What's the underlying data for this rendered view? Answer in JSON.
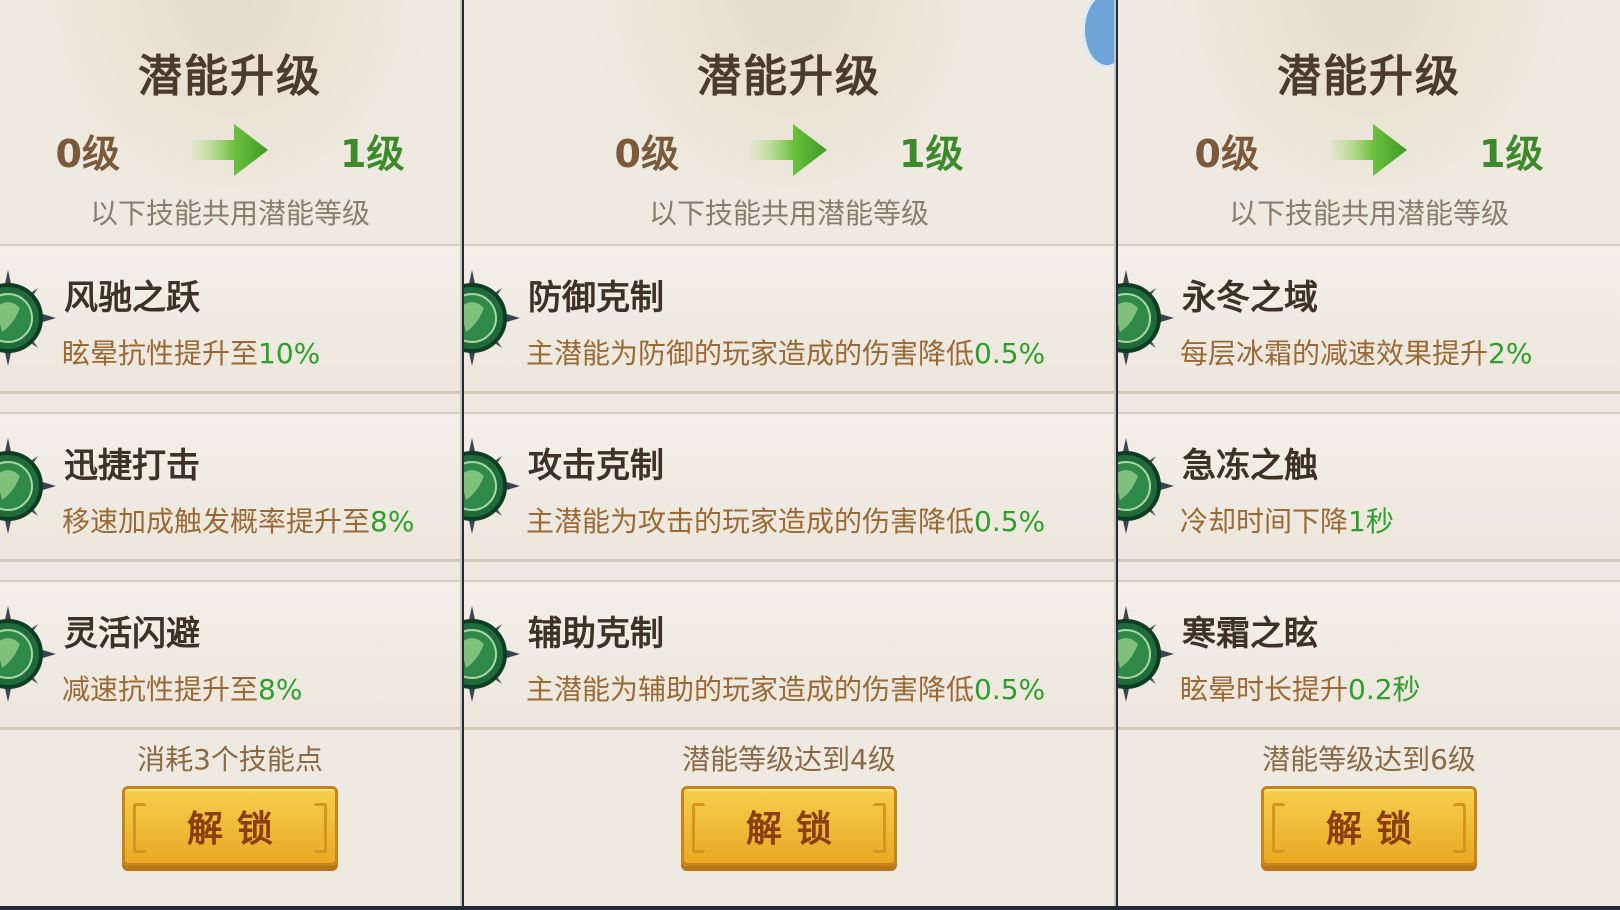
{
  "colors": {
    "panel_bg": "#efeae1",
    "level_from": "#7a5a3a",
    "level_to": "#3d8a2a",
    "value_green": "#2e9e2c",
    "desc_brown": "#9a6a36",
    "button_gold": "#f0bc38"
  },
  "panels": [
    {
      "title": "潜能升级",
      "level_from": "0级",
      "arrow_icon": "green-arrow-right",
      "level_to": "1级",
      "shared_note": "以下技能共用潜能等级",
      "skills": [
        {
          "name": "风驰之跃",
          "desc": "眩晕抗性提升至",
          "value": "10%",
          "icon": "skill-emblem"
        },
        {
          "name": "迅捷打击",
          "desc": "移速加成触发概率提升至",
          "value": "8%",
          "icon": "skill-emblem"
        },
        {
          "name": "灵活闪避",
          "desc": "减速抗性提升至",
          "value": "8%",
          "icon": "skill-emblem"
        }
      ],
      "requirement": "消耗3个技能点",
      "unlock_label": "解锁"
    },
    {
      "title": "潜能升级",
      "level_from": "0级",
      "arrow_icon": "green-arrow-right",
      "level_to": "1级",
      "shared_note": "以下技能共用潜能等级",
      "skills": [
        {
          "name": "防御克制",
          "desc": "主潜能为防御的玩家造成的伤害降低",
          "value": "0.5%",
          "icon": "skill-emblem"
        },
        {
          "name": "攻击克制",
          "desc": "主潜能为攻击的玩家造成的伤害降低",
          "value": "0.5%",
          "icon": "skill-emblem"
        },
        {
          "name": "辅助克制",
          "desc": "主潜能为辅助的玩家造成的伤害降低",
          "value": "0.5%",
          "icon": "skill-emblem"
        }
      ],
      "requirement": "潜能等级达到4级",
      "unlock_label": "解锁"
    },
    {
      "title": "潜能升级",
      "level_from": "0级",
      "arrow_icon": "green-arrow-right",
      "level_to": "1级",
      "shared_note": "以下技能共用潜能等级",
      "skills": [
        {
          "name": "永冬之域",
          "desc": "每层冰霜的减速效果提升",
          "value": "2%",
          "icon": "skill-emblem"
        },
        {
          "name": "急冻之触",
          "desc": "冷却时间下降",
          "value": "1秒",
          "icon": "skill-emblem"
        },
        {
          "name": "寒霜之眩",
          "desc": "眩晕时长提升",
          "value": "0.2秒",
          "icon": "skill-emblem"
        }
      ],
      "requirement": "潜能等级达到6级",
      "unlock_label": "解锁"
    }
  ]
}
